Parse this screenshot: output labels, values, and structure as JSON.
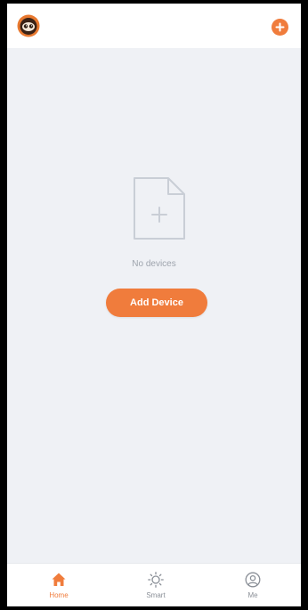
{
  "header": {
    "logo_icon": "owl-logo-icon",
    "add_icon": "plus-circle-icon"
  },
  "empty_state": {
    "icon": "add-file-icon",
    "message": "No devices"
  },
  "actions": {
    "add_device_label": "Add Device"
  },
  "bottom_nav": {
    "tabs": [
      {
        "label": "Home",
        "icon": "home-icon",
        "active": true
      },
      {
        "label": "Smart",
        "icon": "sun-icon",
        "active": false
      },
      {
        "label": "Me",
        "icon": "user-circle-icon",
        "active": false
      }
    ]
  },
  "colors": {
    "accent": "#f07c3c",
    "background": "#eff1f5",
    "muted_text": "#9ea4ad"
  }
}
